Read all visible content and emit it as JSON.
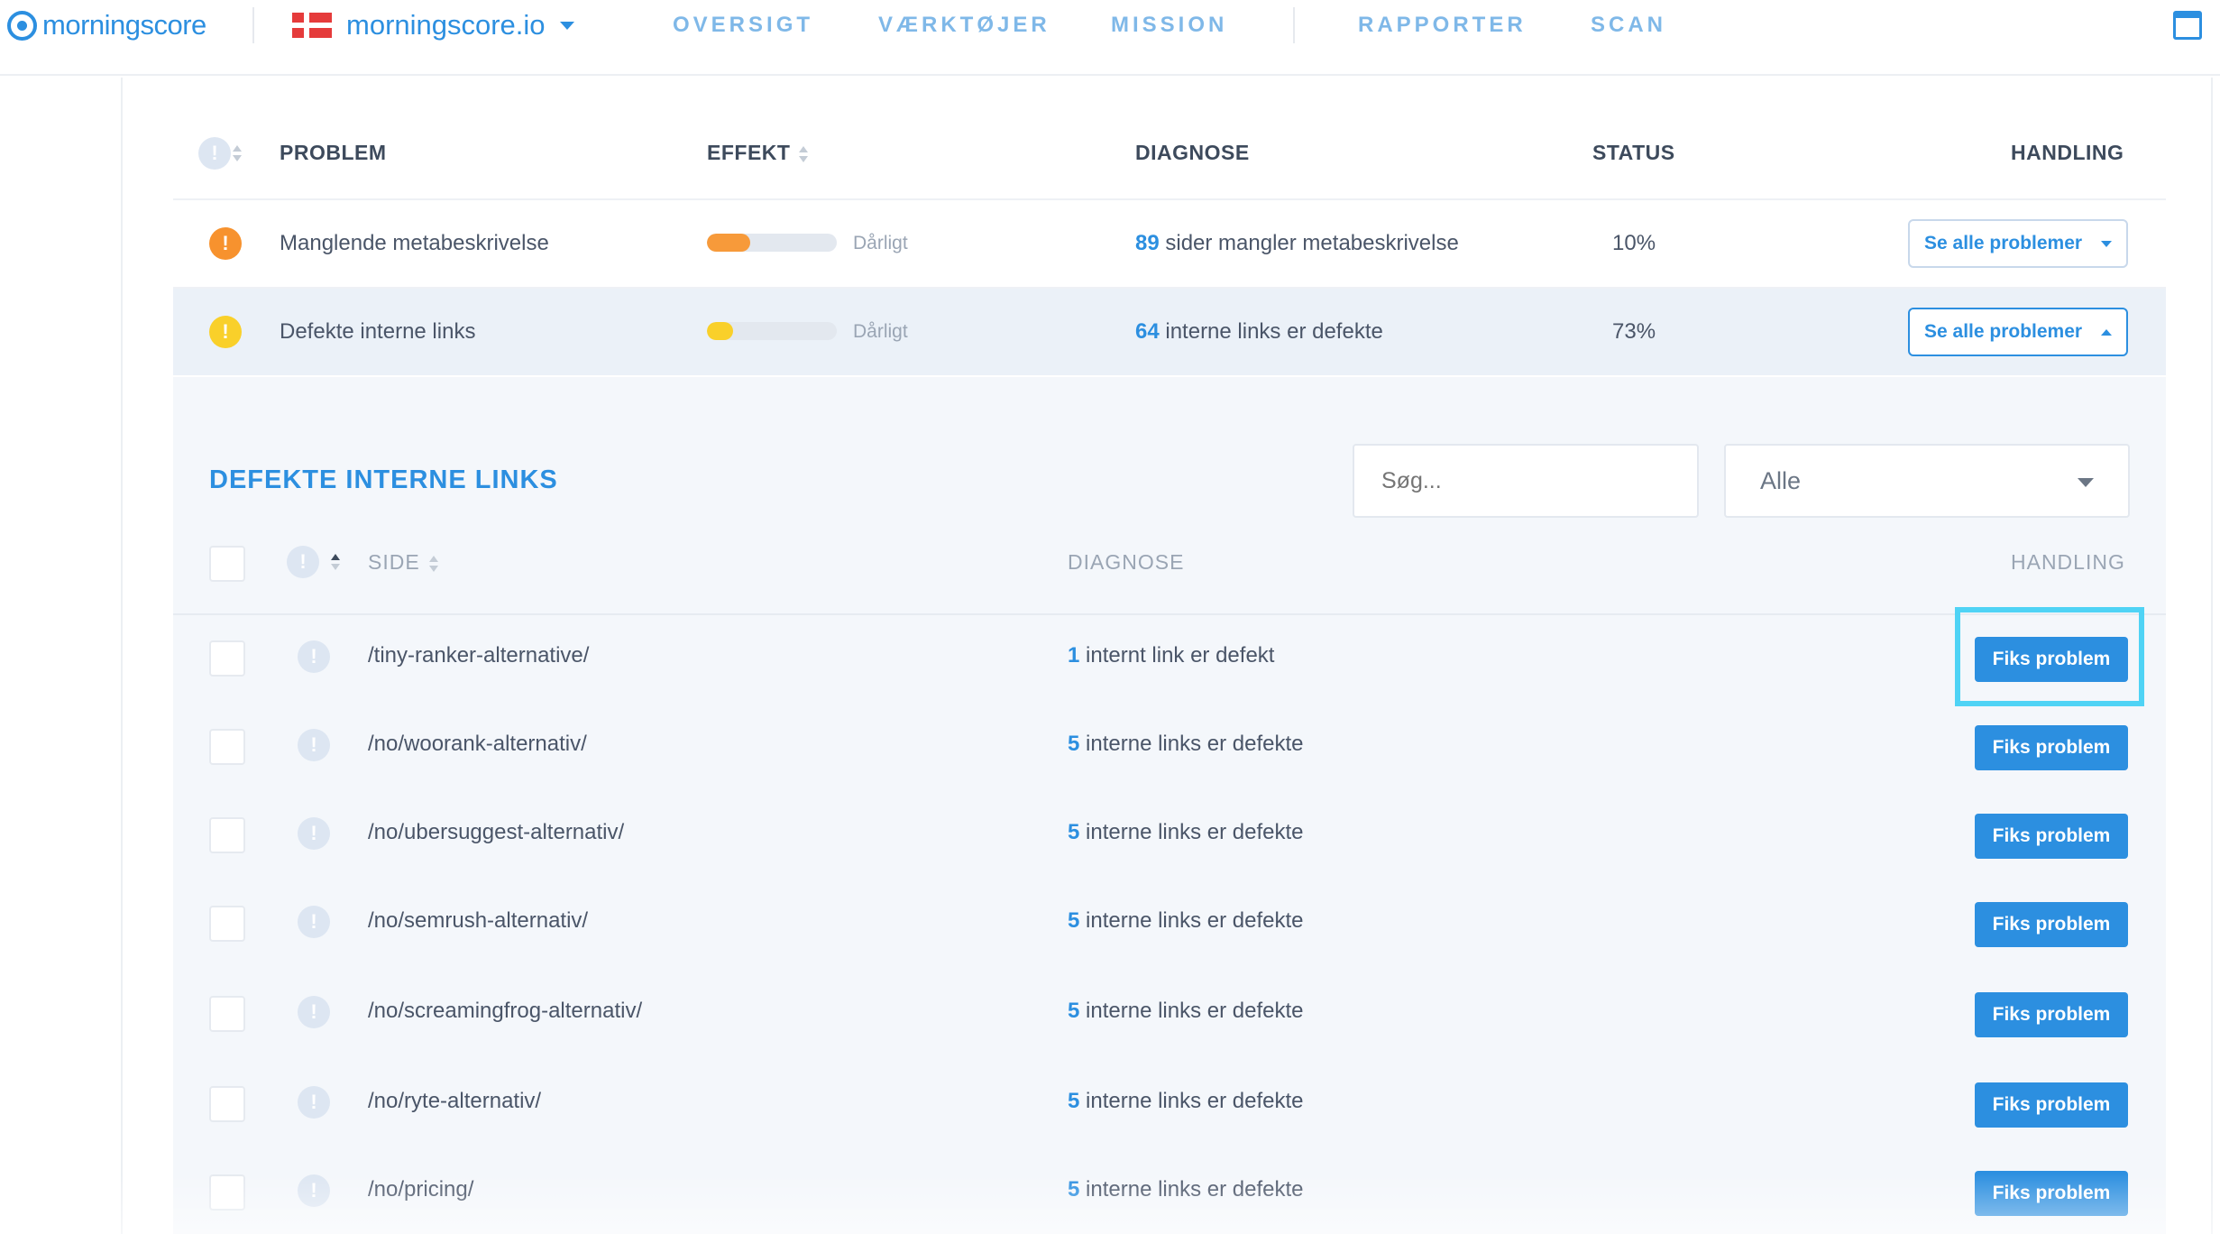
{
  "header": {
    "logo_text": "morningscore",
    "site_name": "morningscore.io",
    "nav": [
      "OVERSIGT",
      "VÆRKTØJER",
      "MISSION",
      "RAPPORTER",
      "SCAN"
    ]
  },
  "table": {
    "headers": {
      "excl": "!",
      "problem": "PROBLEM",
      "effekt": "EFFEKT",
      "diagnose": "DIAGNOSE",
      "status": "STATUS",
      "handling": "HANDLING"
    },
    "rows": [
      {
        "severity_color": "#f7922e",
        "problem": "Manglende metabeskrivelse",
        "effect_fill": 0.33,
        "effect_color": "#f79a3a",
        "effect_label": "Dårligt",
        "diag_num": "89",
        "diag_text": " sider mangler metabeskrivelse",
        "status": "10%",
        "action": "Se alle problemer"
      },
      {
        "severity_color": "#f9d02a",
        "problem": "Defekte interne links",
        "effect_fill": 0.2,
        "effect_color": "#f9d02a",
        "effect_label": "Dårligt",
        "diag_num": "64",
        "diag_text": " interne links er defekte",
        "status": "73%",
        "action": "Se alle problemer"
      }
    ]
  },
  "detail": {
    "title": "DEFEKTE INTERNE LINKS",
    "search_placeholder": "Søg...",
    "filter_value": "Alle",
    "headers": {
      "excl": "!",
      "side": "SIDE",
      "diagnose": "DIAGNOSE",
      "handling": "HANDLING"
    },
    "rows": [
      {
        "excl": "!",
        "path": "/tiny-ranker-alternative/",
        "num": "1",
        "text": " internt link er defekt",
        "action": "Fiks problem"
      },
      {
        "excl": "!",
        "path": "/no/woorank-alternativ/",
        "num": "5",
        "text": " interne links er defekte",
        "action": "Fiks problem"
      },
      {
        "excl": "!",
        "path": "/no/ubersuggest-alternativ/",
        "num": "5",
        "text": " interne links er defekte",
        "action": "Fiks problem"
      },
      {
        "excl": "!",
        "path": "/no/semrush-alternativ/",
        "num": "5",
        "text": " interne links er defekte",
        "action": "Fiks problem"
      },
      {
        "excl": "!",
        "path": "/no/screamingfrog-alternativ/",
        "num": "5",
        "text": " interne links er defekte",
        "action": "Fiks problem"
      },
      {
        "excl": "!",
        "path": "/no/ryte-alternativ/",
        "num": "5",
        "text": " interne links er defekte",
        "action": "Fiks problem"
      },
      {
        "excl": "!",
        "path": "/no/pricing/",
        "num": "5",
        "text": " interne links er defekte",
        "action": "Fiks problem"
      }
    ]
  },
  "colors": {
    "accent": "#2c8fe0",
    "highlight": "#4fd3f5"
  }
}
